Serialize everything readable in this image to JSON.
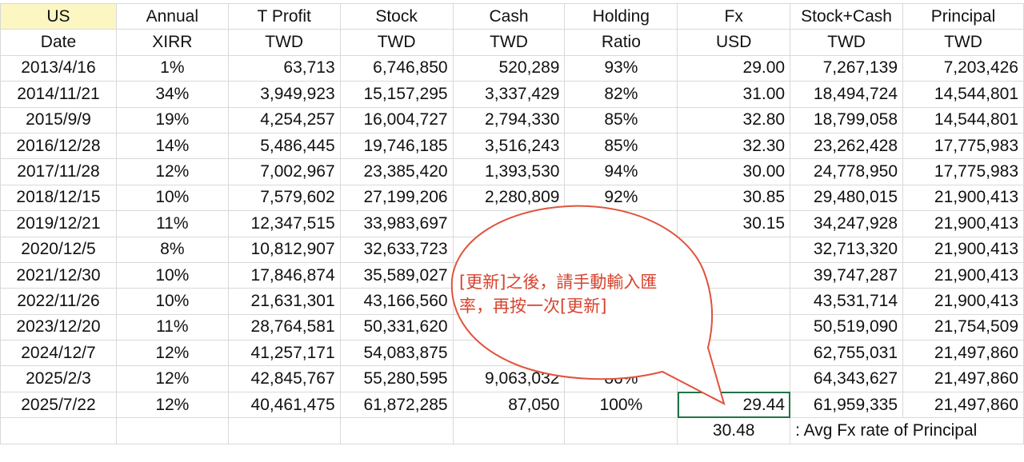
{
  "header1": [
    "US",
    "Annual",
    "T Profit",
    "Stock",
    "Cash",
    "Holding",
    "Fx",
    "Stock+Cash",
    "Principal"
  ],
  "header2": [
    "Date",
    "XIRR",
    "TWD",
    "TWD",
    "TWD",
    "Ratio",
    "USD",
    "TWD",
    "TWD"
  ],
  "rows": [
    [
      "2013/4/16",
      "1%",
      "63,713",
      "6,746,850",
      "520,289",
      "93%",
      "29.00",
      "7,267,139",
      "7,203,426"
    ],
    [
      "2014/11/21",
      "34%",
      "3,949,923",
      "15,157,295",
      "3,337,429",
      "82%",
      "31.00",
      "18,494,724",
      "14,544,801"
    ],
    [
      "2015/9/9",
      "19%",
      "4,254,257",
      "16,004,727",
      "2,794,330",
      "85%",
      "32.80",
      "18,799,058",
      "14,544,801"
    ],
    [
      "2016/12/28",
      "14%",
      "5,486,445",
      "19,746,185",
      "3,516,243",
      "85%",
      "32.30",
      "23,262,428",
      "17,775,983"
    ],
    [
      "2017/11/28",
      "12%",
      "7,002,967",
      "23,385,420",
      "1,393,530",
      "94%",
      "30.00",
      "24,778,950",
      "17,775,983"
    ],
    [
      "2018/12/15",
      "10%",
      "7,579,602",
      "27,199,206",
      "2,280,809",
      "92%",
      "30.85",
      "29,480,015",
      "21,900,413"
    ],
    [
      "2019/12/21",
      "11%",
      "12,347,515",
      "33,983,697",
      "",
      "",
      "30.15",
      "34,247,928",
      "21,900,413"
    ],
    [
      "2020/12/5",
      "8%",
      "10,812,907",
      "32,633,723",
      "",
      "",
      "",
      "32,713,320",
      "21,900,413"
    ],
    [
      "2021/12/30",
      "10%",
      "17,846,874",
      "35,589,027",
      "",
      "",
      "",
      "39,747,287",
      "21,900,413"
    ],
    [
      "2022/11/26",
      "10%",
      "21,631,301",
      "43,166,560",
      "",
      "",
      "",
      "43,531,714",
      "21,900,413"
    ],
    [
      "2023/12/20",
      "11%",
      "28,764,581",
      "50,331,620",
      "",
      "",
      "",
      "50,519,090",
      "21,754,509"
    ],
    [
      "2024/12/7",
      "12%",
      "41,257,171",
      "54,083,875",
      "",
      "",
      "",
      "62,755,031",
      "21,497,860"
    ],
    [
      "2025/2/3",
      "12%",
      "42,845,767",
      "55,280,595",
      "9,063,032",
      "86%",
      "",
      "64,343,627",
      "21,497,860"
    ],
    [
      "2025/7/22",
      "12%",
      "40,461,475",
      "61,872,285",
      "87,050",
      "100%",
      "29.44",
      "61,959,335",
      "21,497,860"
    ]
  ],
  "footer": {
    "avg_fx": "30.48",
    "avg_fx_label": ": Avg Fx rate of Principal"
  },
  "callout": {
    "line1": "[更新]之後，請手動輸入匯",
    "line2": "率，再按一次[更新]",
    "border_color": "#e0533c",
    "text_color": "#d7432e"
  }
}
